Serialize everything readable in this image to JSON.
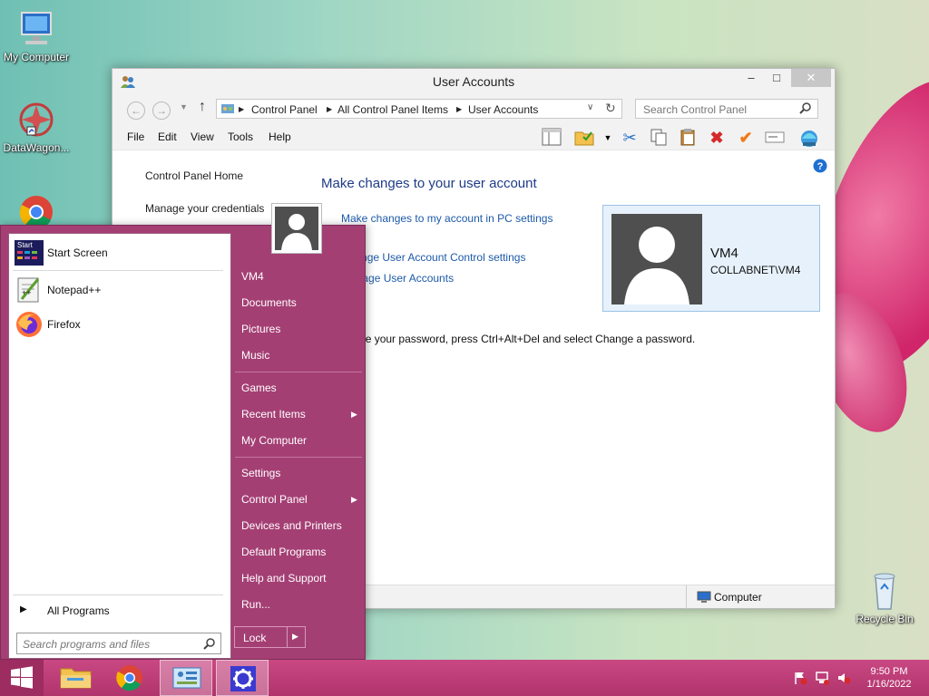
{
  "desktop": {
    "icons": [
      {
        "label": "My Computer",
        "icon": "computer-icon"
      },
      {
        "label": "DataWagon...",
        "icon": "datawagon-icon"
      },
      {
        "label": "Recycle Bin",
        "icon": "recycle-bin-icon"
      }
    ]
  },
  "window": {
    "title": "User Accounts",
    "controls": {
      "minimize": "–",
      "maximize": "□",
      "close": "✕"
    },
    "address": {
      "segments": [
        "Control Panel",
        "All Control Panel Items",
        "User Accounts"
      ]
    },
    "search_placeholder": "Search Control Panel",
    "menu": [
      "File",
      "Edit",
      "View",
      "Tools",
      "Help"
    ],
    "sidebar": {
      "items": [
        "Control Panel Home",
        "Manage your credentials"
      ]
    },
    "main": {
      "heading": "Make changes to your user account",
      "links": [
        "Make changes to my account in PC settings",
        "Change User Account Control settings",
        "Manage User Accounts"
      ],
      "password_note": "To change your password, press Ctrl+Alt+Del and select Change a password."
    },
    "user": {
      "name": "VM4",
      "domain": "COLLABNET\\VM4"
    },
    "status": {
      "location": "Computer"
    }
  },
  "start_menu": {
    "pinned": [
      {
        "label": "Start Screen",
        "icon": "start-screen-icon"
      },
      {
        "label": "Notepad++",
        "icon": "notepad-plus-plus-icon"
      },
      {
        "label": "Firefox",
        "icon": "firefox-icon"
      }
    ],
    "all_programs": "All Programs",
    "search_placeholder": "Search programs and files",
    "right": {
      "items": [
        "VM4",
        "Documents",
        "Pictures",
        "Music",
        "Games",
        "Recent Items",
        "My Computer",
        "Settings",
        "Control Panel",
        "Devices and Printers",
        "Default Programs",
        "Help and Support",
        "Run..."
      ]
    },
    "lock_label": "Lock"
  },
  "taskbar": {
    "time": "9:50 PM",
    "date": "1/16/2022"
  },
  "colors": {
    "start_menu_bg": "#a43f74",
    "taskbar": "#c04079",
    "link": "#1c5aa8",
    "heading": "#1e3b87"
  }
}
